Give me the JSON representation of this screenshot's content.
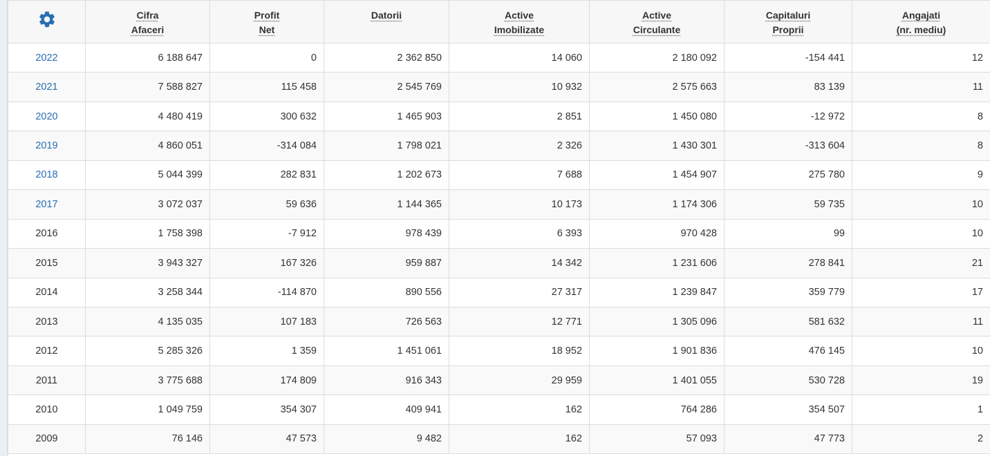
{
  "table": {
    "settings_icon": "gear-icon",
    "columns": [
      {
        "line1": "Cifra",
        "line2": "Afaceri"
      },
      {
        "line1": "Profit",
        "line2": "Net"
      },
      {
        "line1": "Datorii",
        "line2": ""
      },
      {
        "line1": "Active",
        "line2": "Imobilizate"
      },
      {
        "line1": "Active",
        "line2": "Circulante"
      },
      {
        "line1": "Capitaluri",
        "line2": "Proprii"
      },
      {
        "line1": "Angajati",
        "line2": "(nr. mediu)"
      }
    ],
    "rows": [
      {
        "year": "2022",
        "link": true,
        "values": [
          "6 188 647",
          "0",
          "2 362 850",
          "14 060",
          "2 180 092",
          "-154 441",
          "12"
        ]
      },
      {
        "year": "2021",
        "link": true,
        "values": [
          "7 588 827",
          "115 458",
          "2 545 769",
          "10 932",
          "2 575 663",
          "83 139",
          "11"
        ]
      },
      {
        "year": "2020",
        "link": true,
        "values": [
          "4 480 419",
          "300 632",
          "1 465 903",
          "2 851",
          "1 450 080",
          "-12 972",
          "8"
        ]
      },
      {
        "year": "2019",
        "link": true,
        "values": [
          "4 860 051",
          "-314 084",
          "1 798 021",
          "2 326",
          "1 430 301",
          "-313 604",
          "8"
        ]
      },
      {
        "year": "2018",
        "link": true,
        "values": [
          "5 044 399",
          "282 831",
          "1 202 673",
          "7 688",
          "1 454 907",
          "275 780",
          "9"
        ]
      },
      {
        "year": "2017",
        "link": true,
        "values": [
          "3 072 037",
          "59 636",
          "1 144 365",
          "10 173",
          "1 174 306",
          "59 735",
          "10"
        ]
      },
      {
        "year": "2016",
        "link": false,
        "values": [
          "1 758 398",
          "-7 912",
          "978 439",
          "6 393",
          "970 428",
          "99",
          "10"
        ]
      },
      {
        "year": "2015",
        "link": false,
        "values": [
          "3 943 327",
          "167 326",
          "959 887",
          "14 342",
          "1 231 606",
          "278 841",
          "21"
        ]
      },
      {
        "year": "2014",
        "link": false,
        "values": [
          "3 258 344",
          "-114 870",
          "890 556",
          "27 317",
          "1 239 847",
          "359 779",
          "17"
        ]
      },
      {
        "year": "2013",
        "link": false,
        "values": [
          "4 135 035",
          "107 183",
          "726 563",
          "12 771",
          "1 305 096",
          "581 632",
          "11"
        ]
      },
      {
        "year": "2012",
        "link": false,
        "values": [
          "5 285 326",
          "1 359",
          "1 451 061",
          "18 952",
          "1 901 836",
          "476 145",
          "10"
        ]
      },
      {
        "year": "2011",
        "link": false,
        "values": [
          "3 775 688",
          "174 809",
          "916 343",
          "29 959",
          "1 401 055",
          "530 728",
          "19"
        ]
      },
      {
        "year": "2010",
        "link": false,
        "values": [
          "1 049 759",
          "354 307",
          "409 941",
          "162",
          "764 286",
          "354 507",
          "1"
        ]
      },
      {
        "year": "2009",
        "link": false,
        "values": [
          "76 146",
          "47 573",
          "9 482",
          "162",
          "57 093",
          "47 773",
          "2"
        ]
      }
    ]
  },
  "colors": {
    "link": "#2a6db5",
    "gear": "#2a6db5",
    "header_bg": "#f7f7f7",
    "border": "#dcdcdc"
  }
}
